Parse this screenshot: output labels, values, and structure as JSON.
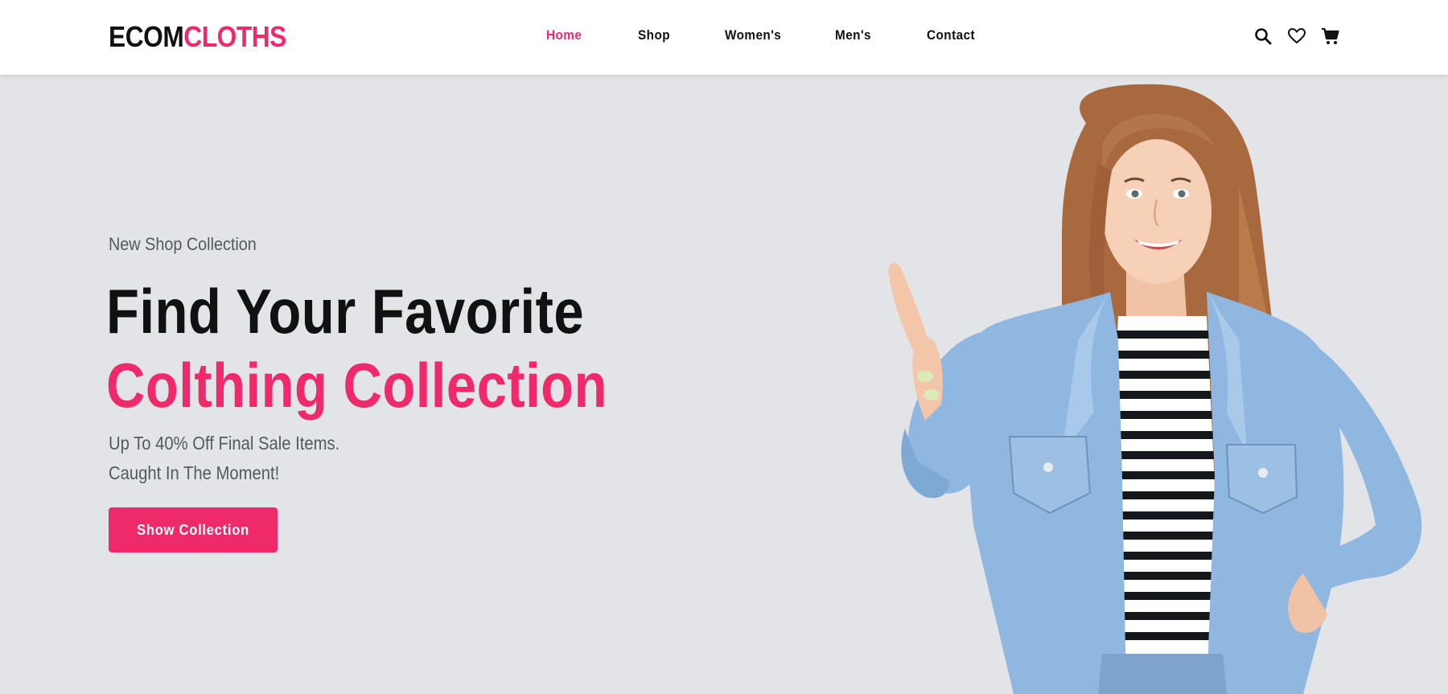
{
  "brand": {
    "part1": "ECOM",
    "part2": "CLOTHS"
  },
  "nav": {
    "items": [
      {
        "label": "Home",
        "active": true
      },
      {
        "label": "Shop",
        "active": false
      },
      {
        "label": "Women's",
        "active": false
      },
      {
        "label": "Men's",
        "active": false
      },
      {
        "label": "Contact",
        "active": false
      }
    ]
  },
  "header_icons": [
    "search-icon",
    "heart-icon",
    "cart-icon"
  ],
  "hero": {
    "eyebrow": "New Shop Collection",
    "title_line1": "Find Your Favorite",
    "title_line2": "Colthing Collection",
    "subtitle_line1": "Up To 40% Off Final Sale Items.",
    "subtitle_line2": "Caught In The Moment!",
    "cta_label": "Show Collection"
  },
  "colors": {
    "accent": "#ee2a6b",
    "text_dark": "#111111",
    "text_muted": "#555a60",
    "hero_bg": "#e2e4e7",
    "header_bg": "#ffffff"
  }
}
